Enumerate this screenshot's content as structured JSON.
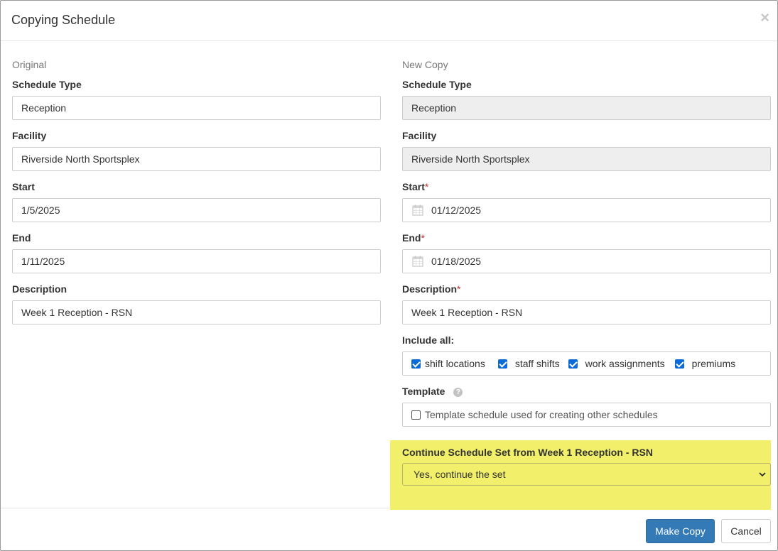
{
  "dialog": {
    "title": "Copying Schedule",
    "close_glyph": "×"
  },
  "original": {
    "heading": "Original",
    "schedule_type_label": "Schedule Type",
    "schedule_type_value": "Reception",
    "facility_label": "Facility",
    "facility_value": "Riverside North Sportsplex",
    "start_label": "Start",
    "start_value": "1/5/2025",
    "end_label": "End",
    "end_value": "1/11/2025",
    "description_label": "Description",
    "description_value": "Week 1 Reception - RSN"
  },
  "new_copy": {
    "heading": "New Copy",
    "schedule_type_label": "Schedule Type",
    "schedule_type_value": "Reception",
    "facility_label": "Facility",
    "facility_value": "Riverside North Sportsplex",
    "start_label": "Start",
    "start_value": "01/12/2025",
    "end_label": "End",
    "end_value": "01/18/2025",
    "description_label": "Description",
    "description_value": "Week 1 Reception - RSN",
    "required_mark": "*",
    "include_all_label": "Include all:",
    "include_options": [
      {
        "label": "shift locations",
        "checked": true
      },
      {
        "label": "staff shifts",
        "checked": true
      },
      {
        "label": "work assignments",
        "checked": true
      },
      {
        "label": "premiums",
        "checked": true
      }
    ],
    "template_label": "Template",
    "template_help_glyph": "?",
    "template_checkbox_label": "Template schedule used for creating other schedules",
    "template_checked": false,
    "continue_label": "Continue Schedule Set from Week 1 Reception - RSN",
    "continue_selected": "Yes, continue the set"
  },
  "footer": {
    "make_copy_label": "Make Copy",
    "cancel_label": "Cancel"
  },
  "colors": {
    "primary": "#337ab7",
    "highlight": "#f2f06a",
    "required": "#c9302c",
    "checkbox": "#0b6bd6"
  },
  "icons": {
    "close": "close-icon",
    "calendar": "calendar-icon",
    "help": "help-icon",
    "dropdown": "chevron-down-icon"
  }
}
